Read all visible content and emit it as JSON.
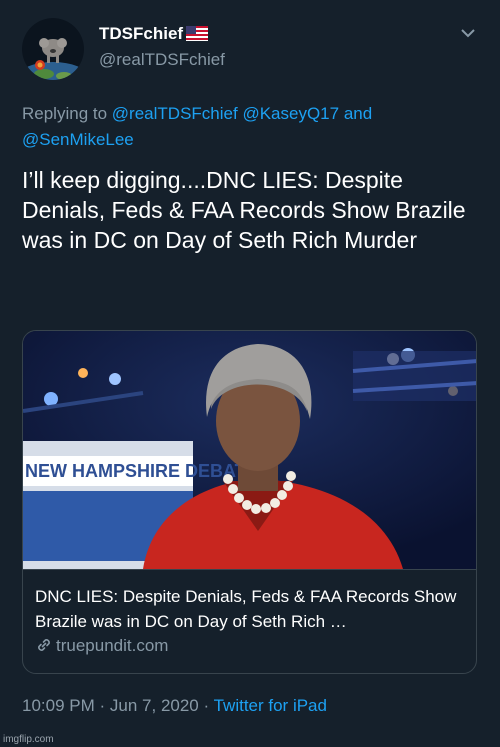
{
  "user": {
    "display_name": "TDSFchief",
    "handle": "@realTDSFchief",
    "flag_icon": "us-flag-icon",
    "avatar_icon": "koala-globe-avatar"
  },
  "reply": {
    "prefix": "Replying to",
    "mentions": [
      "@realTDSFchief",
      "@KaseyQ17",
      "@SenMikeLee"
    ],
    "conjunction": "and"
  },
  "tweet": {
    "text": "I’ll keep digging....DNC LIES: Despite Denials, Feds & FAA Records Show Brazile was in DC on Day of Seth Rich Murder"
  },
  "card": {
    "title": "DNC LIES: Despite Denials, Feds & FAA Records Show Brazile was in DC on Day of Seth Rich …",
    "domain": "truepundit.com",
    "image_text": "NEW HAMPSHIRE DEBATE"
  },
  "meta": {
    "time": "10:09 PM",
    "separator": "·",
    "date": "Jun 7, 2020",
    "source": "Twitter for iPad"
  },
  "watermark": "imgflip.com",
  "colors": {
    "background": "#15202b",
    "text": "#ffffff",
    "secondary": "#8899a6",
    "accent": "#1da1f2",
    "border": "#38444d"
  }
}
